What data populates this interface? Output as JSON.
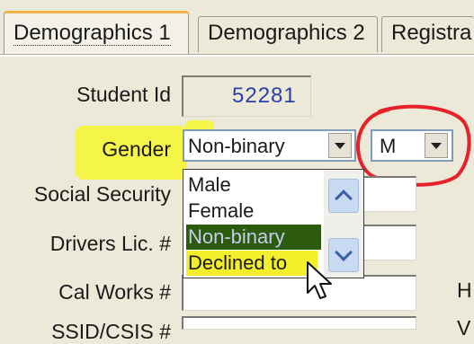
{
  "tabs": [
    {
      "label": "Demographics 1",
      "active": true
    },
    {
      "label": "Demographics 2",
      "active": false
    },
    {
      "label": "Registra",
      "active": false
    }
  ],
  "form": {
    "student_id_label": "Student Id",
    "student_id_value": "52281",
    "gender_label": "Gender",
    "gender_value": "Non-binary",
    "gender_options": [
      "Male",
      "Female",
      "Non-binary",
      "Declined to"
    ],
    "gender_selected_index": 2,
    "sex_value": "M",
    "ssn_label": "Social Security",
    "drivers_label": "Drivers Lic. #",
    "calworks_label": "Cal Works #",
    "ssid_label": "SSID/CSIS #",
    "right_partial_1": "H",
    "right_partial_2": "V"
  },
  "icons": {
    "dropdown": "triangle-down",
    "scroll_up": "chevron-up-icon",
    "scroll_down": "chevron-down-icon",
    "cursor": "mouse-pointer-icon"
  },
  "colors": {
    "background": "#ece9d8",
    "highlight_yellow": "#f5f53a",
    "annotation_red": "#e8202a",
    "selection": "#2d5b0d",
    "id_text": "#2b3fa6"
  }
}
